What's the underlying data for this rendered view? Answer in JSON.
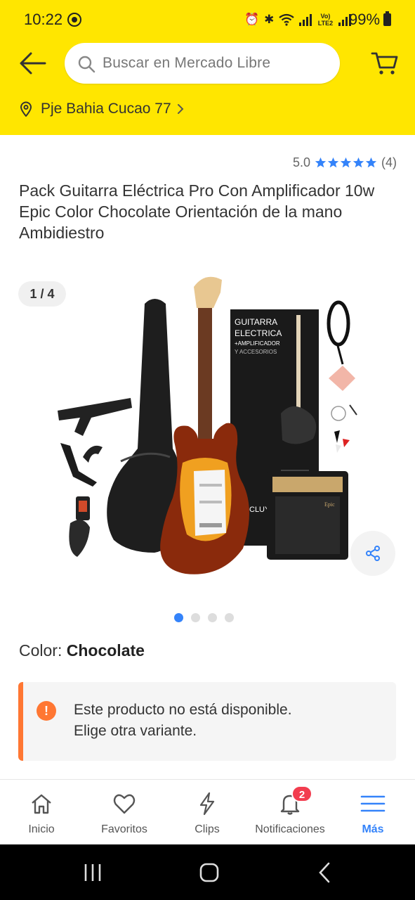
{
  "status_bar": {
    "time": "10:22",
    "network_label": "Vo) LTE2",
    "battery": "99%"
  },
  "header": {
    "search_placeholder": "Buscar en Mercado Libre",
    "location": "Pje Bahia Cucao 77"
  },
  "product": {
    "rating_score": "5.0",
    "rating_stars": 5,
    "rating_count": "(4)",
    "title": "Pack Guitarra Eléctrica Pro Con Amplificador 10w Epic Color Chocolate Orientación de la mano Ambidiestro",
    "gallery_counter": "1 / 4",
    "gallery_total": 4,
    "gallery_active_index": 1,
    "image_box_text_1": "GUITARRA",
    "image_box_text_2": "ELECTRICA",
    "image_box_text_3": "+AMPLIFICADOR",
    "image_box_text_4": "Y ACCESORIOS",
    "image_box_text_5": "INCLUYE",
    "color_label": "Color:",
    "color_value": "Chocolate"
  },
  "notice": {
    "icon": "!",
    "line1": "Este producto no está disponible.",
    "line2": "Elige otra variante."
  },
  "bottom_nav": {
    "items": [
      {
        "label": "Inicio",
        "icon": "home-icon"
      },
      {
        "label": "Favoritos",
        "icon": "heart-icon"
      },
      {
        "label": "Clips",
        "icon": "lightning-icon"
      },
      {
        "label": "Notificaciones",
        "icon": "bell-icon",
        "badge": "2"
      },
      {
        "label": "Más",
        "icon": "menu-icon",
        "active": true
      }
    ]
  },
  "colors": {
    "brand_yellow": "#ffe600",
    "accent_blue": "#3483fa",
    "warning_orange": "#ff7733",
    "badge_red": "#f23d4f"
  }
}
